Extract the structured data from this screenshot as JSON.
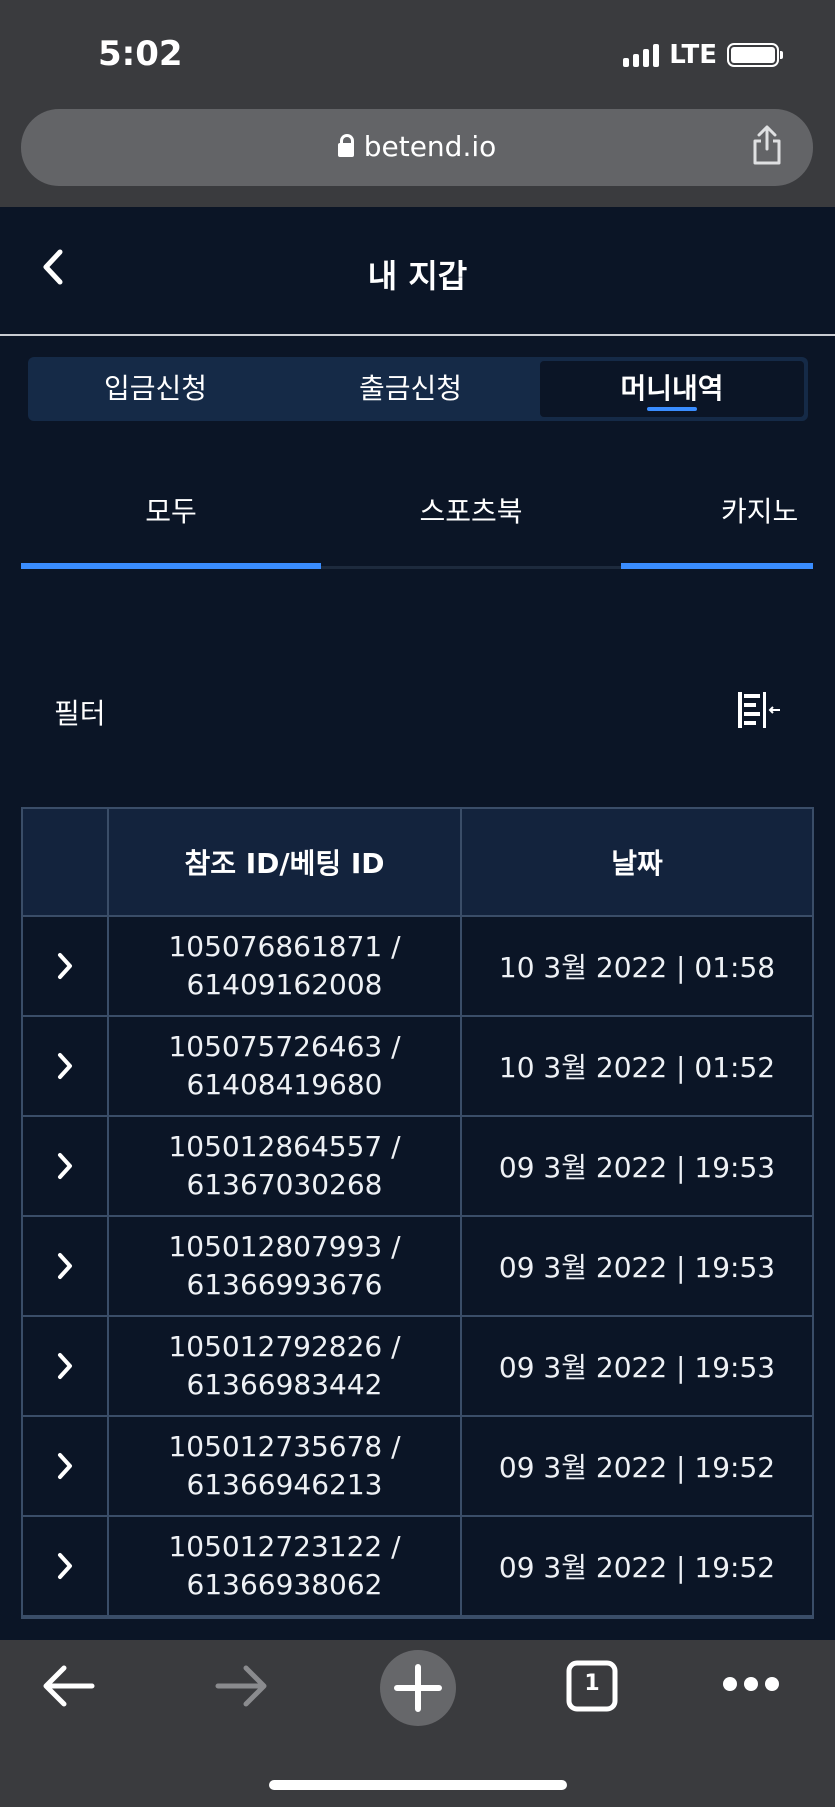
{
  "status_bar": {
    "time": "5:02",
    "network": "LTE"
  },
  "browser": {
    "url": "betend.io"
  },
  "header": {
    "title": "내 지갑"
  },
  "segment_tabs": [
    {
      "label": "입금신청",
      "active": false
    },
    {
      "label": "출금신청",
      "active": false
    },
    {
      "label": "머니내역",
      "active": true
    }
  ],
  "filter_tabs": [
    {
      "label": "모두",
      "active": true
    },
    {
      "label": "스포츠북",
      "active": false
    },
    {
      "label": "카지노",
      "active": true
    }
  ],
  "filter": {
    "label": "필터"
  },
  "table": {
    "headers": [
      "",
      "참조 ID/베팅 ID",
      "날짜"
    ],
    "rows": [
      {
        "ref": "105076861871 /",
        "bet": "61409162008",
        "date": "10 3월 2022 | 01:58"
      },
      {
        "ref": "105075726463 /",
        "bet": "61408419680",
        "date": "10 3월 2022 | 01:52"
      },
      {
        "ref": "105012864557 /",
        "bet": "61367030268",
        "date": "09 3월 2022 | 19:53"
      },
      {
        "ref": "105012807993 /",
        "bet": "61366993676",
        "date": "09 3월 2022 | 19:53"
      },
      {
        "ref": "105012792826 /",
        "bet": "61366983442",
        "date": "09 3월 2022 | 19:53"
      },
      {
        "ref": "105012735678 /",
        "bet": "61366946213",
        "date": "09 3월 2022 | 19:52"
      },
      {
        "ref": "105012723122 /",
        "bet": "61366938062",
        "date": "09 3월 2022 | 19:52"
      }
    ]
  },
  "toolbar": {
    "tab_count": "1"
  },
  "colors": {
    "accent": "#3a8dff",
    "background": "#0b1526",
    "panel": "#152a47",
    "chrome": "#3a3b3e"
  }
}
